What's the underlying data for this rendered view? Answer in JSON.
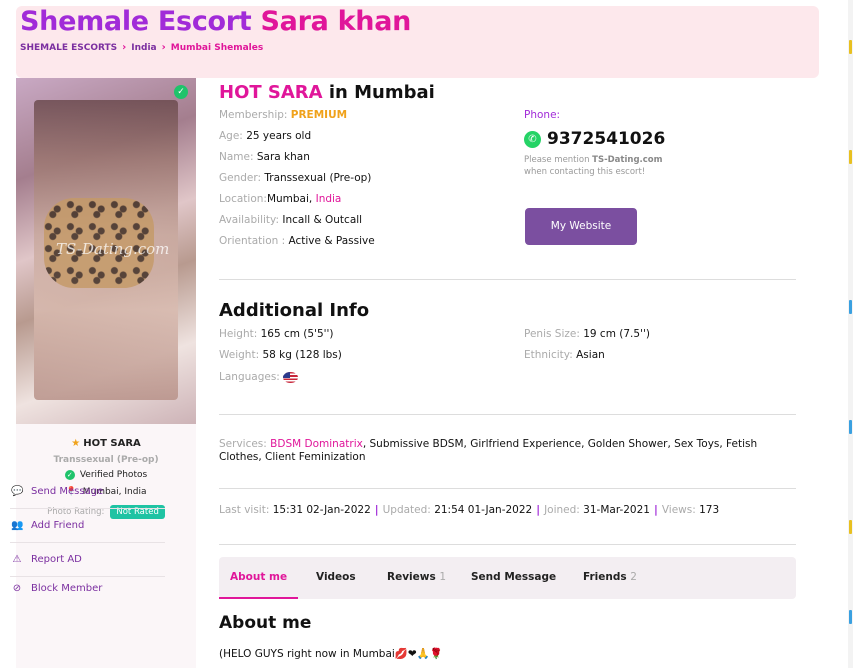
{
  "header": {
    "title_part1": "Shemale Escort",
    "title_part2": "Sara khan",
    "breadcrumbs": [
      "SHEMALE ESCORTS",
      "India",
      "Mumbai Shemales"
    ]
  },
  "profile_card": {
    "watermark": "TS-Dating.com",
    "name": "HOT SARA",
    "gender": "Transsexual (Pre-op)",
    "verified_text": "Verified Photos",
    "location": "Mumbai, India",
    "photo_rating_label": "Photo Rating:",
    "photo_rating_badge": "Not Rated"
  },
  "side_menu": [
    {
      "label": "Send Message",
      "icon": "chat-icon"
    },
    {
      "label": "Add Friend",
      "icon": "users-icon"
    },
    {
      "label": "Report AD",
      "icon": "warning-icon"
    },
    {
      "label": "Block Member",
      "icon": "block-icon"
    }
  ],
  "main": {
    "heading_name": "HOT SARA",
    "heading_rest": "in Mumbai",
    "membership_label": "Membership:",
    "membership_value": "PREMIUM",
    "age_label": "Age:",
    "age_value": "25 years old",
    "name_label": "Name:",
    "name_value": "Sara khan",
    "gender_label": "Gender:",
    "gender_value": "Transsexual (Pre-op)",
    "location_label": "Location:",
    "location_city": "Mumbai,",
    "location_country": "India",
    "availability_label": "Availability:",
    "availability_value": "Incall & Outcall",
    "orientation_label": "Orientation :",
    "orientation_value": "Active & Passive",
    "phone_label": "Phone:",
    "phone_number": "9372541026",
    "mention_text1": "Please mention",
    "mention_site": "TS-Dating.com",
    "mention_text2": "when contacting this escort!",
    "website_button": "My Website"
  },
  "additional": {
    "heading": "Additional Info",
    "height_label": "Height:",
    "height_value": "165 cm (5'5'')",
    "weight_label": "Weight:",
    "weight_value": "58 kg (128 lbs)",
    "languages_label": "Languages:",
    "penis_label": "Penis Size:",
    "penis_value": "19 cm (7.5'')",
    "ethnicity_label": "Ethnicity:",
    "ethnicity_value": "Asian"
  },
  "services": {
    "label": "Services:",
    "highlight": "BDSM Dominatrix",
    "rest": ", Submissive BDSM, Girlfriend Experience, Golden Shower, Sex Toys, Fetish Clothes, Client Feminization"
  },
  "stats": {
    "last_visit_label": "Last visit:",
    "last_visit_value": "15:31 02-Jan-2022",
    "updated_label": "Updated:",
    "updated_value": "21:54 01-Jan-2022",
    "joined_label": "Joined:",
    "joined_value": "31-Mar-2021",
    "views_label": "Views:",
    "views_value": "173",
    "separator": "|"
  },
  "tabs": [
    {
      "label": "About me",
      "count": ""
    },
    {
      "label": "Videos",
      "count": ""
    },
    {
      "label": "Reviews",
      "count": "1"
    },
    {
      "label": "Send Message",
      "count": ""
    },
    {
      "label": "Friends",
      "count": "2"
    }
  ],
  "about": {
    "heading": "About me",
    "text": "(HELO GUYS right now in Mumbai💋❤🙏🌹"
  },
  "colors": {
    "purple": "#a12bd8",
    "pink": "#e0169a",
    "premium": "#f0a21b",
    "button": "#7b4fa0",
    "header_bg": "#fde8ec"
  }
}
